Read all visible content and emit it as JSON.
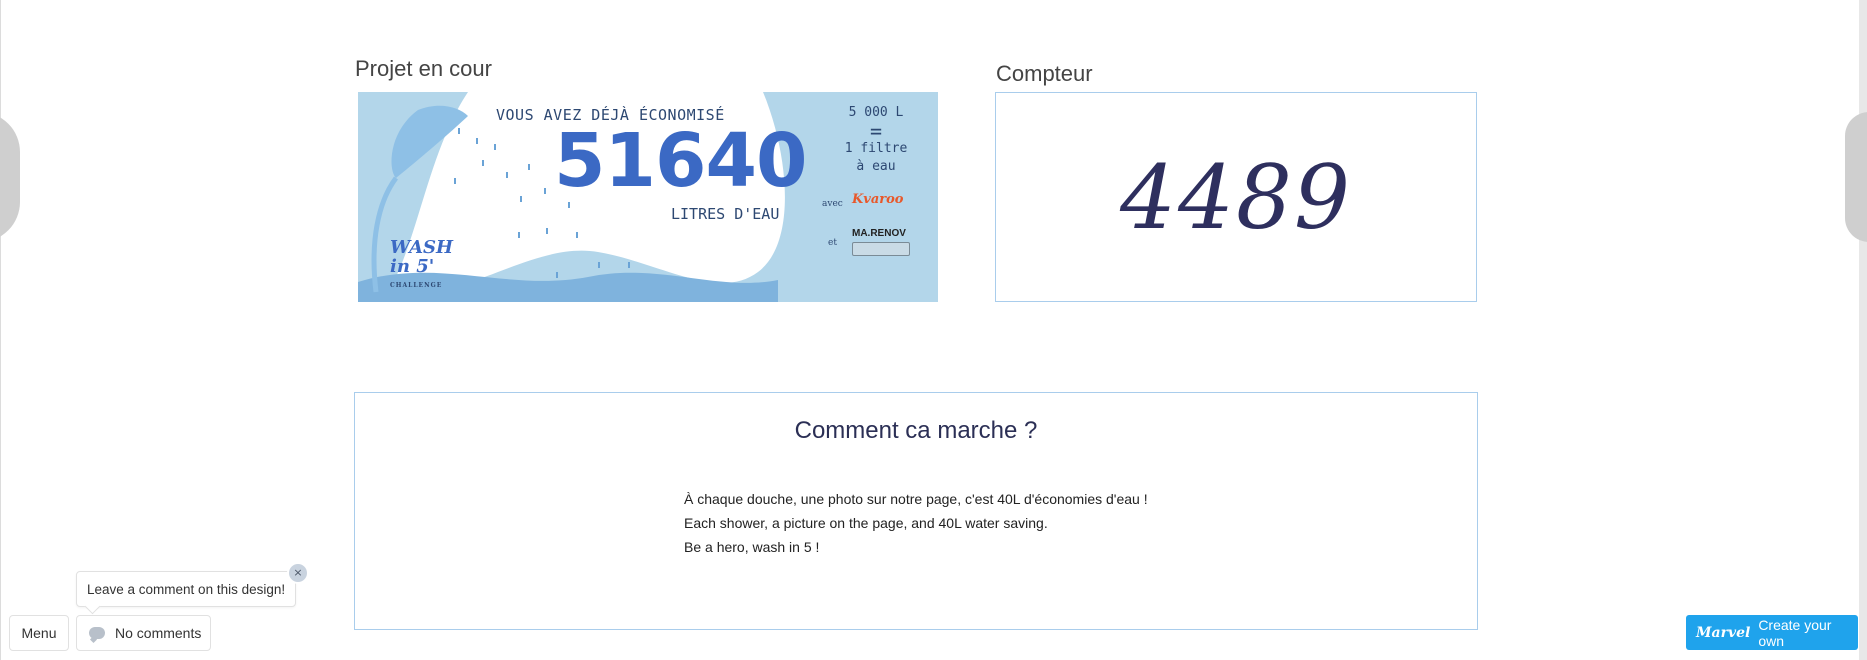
{
  "sections": {
    "project_title": "Projet en cour",
    "counter_title": "Compteur"
  },
  "banner": {
    "headline": "VOUS AVEZ DÉJÀ ÉCONOMISÉ",
    "amount": "51640",
    "unit": "LITRES D'EAU",
    "rate_top": "5 000 L",
    "rate_eq": "=",
    "rate_line1": "1 filtre",
    "rate_line2": "à eau",
    "avec": "avec",
    "partner1": "Kvaroo",
    "et": "et",
    "partner2": "MA.RENOV",
    "logo_line1": "WASH",
    "logo_line2": "in 5'",
    "logo_small": "CHALLENGE"
  },
  "counter": {
    "value": "4489"
  },
  "how": {
    "title": "Comment ca marche ?",
    "lines": [
      "À chaque douche, une photo sur notre page, c'est 40L d'économies d'eau !",
      "Each shower, a picture on the page, and 40L water saving.",
      "Be a hero, wash in 5 !"
    ]
  },
  "overlay": {
    "tooltip": "Leave a comment on this design!",
    "tooltip_close": "×",
    "menu_label": "Menu",
    "comments_label": "No comments",
    "marvel_logo": "Marvel",
    "marvel_cta": "Create your own"
  },
  "colors": {
    "accent": "#1fa3ec",
    "border": "#a9cdec",
    "banner_bg": "#b3d6ea",
    "counter_text": "#2e2f5e"
  },
  "icons": [
    "close-icon",
    "comment-bubble-icon",
    "marvel-logo-icon"
  ]
}
